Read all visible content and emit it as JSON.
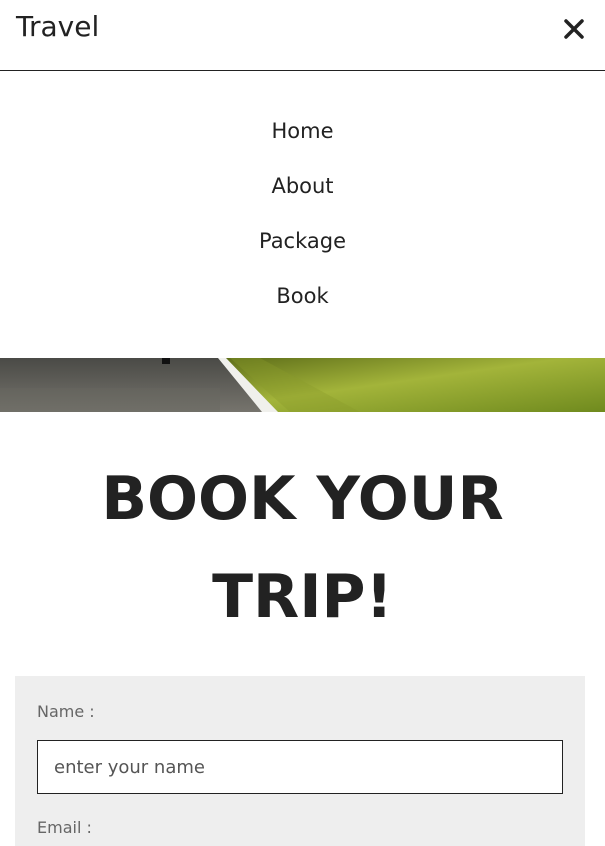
{
  "header": {
    "brand": "Travel",
    "close_icon": "close-icon"
  },
  "nav": {
    "items": [
      {
        "label": "Home"
      },
      {
        "label": "About"
      },
      {
        "label": "Package"
      },
      {
        "label": "Book"
      }
    ]
  },
  "main": {
    "heading_line1": "BOOK YOUR",
    "heading_line2": "TRIP!"
  },
  "form": {
    "name_label": "Name :",
    "name_placeholder": "enter your name",
    "email_label": "Email :"
  }
}
